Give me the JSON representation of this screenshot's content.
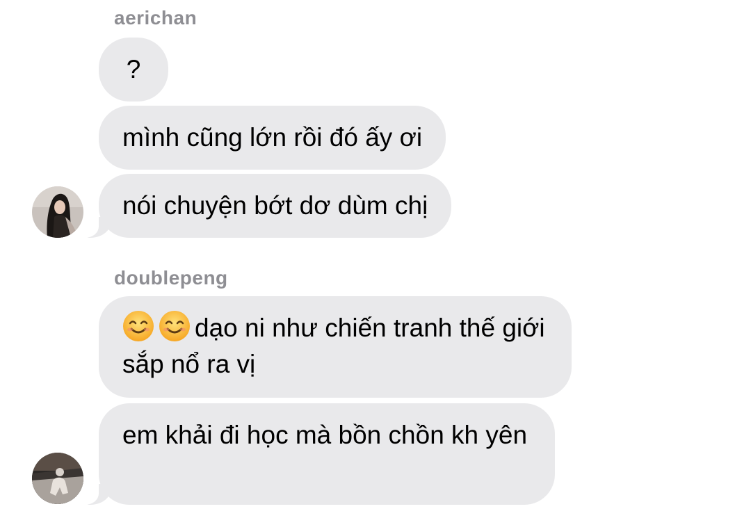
{
  "thread": [
    {
      "sender": "aerichan",
      "messages": [
        "?",
        "mình cũng lớn rồi đó ấy ơi",
        "nói chuyện bớt dơ dùm chị"
      ]
    },
    {
      "sender": "doublepeng",
      "messages": [
        "dạo ni như chiến tranh thế giới sắp nổ ra vị",
        "em khải đi học mà bồn chồn kh yên"
      ]
    }
  ],
  "icons": {
    "avatar_aerichan": "profile-photo-avatar",
    "avatar_doublepeng": "profile-photo-avatar",
    "emoji": "smiling-face-with-smiling-eyes"
  },
  "colors": {
    "bubble": "#e9e9eb",
    "sender_name": "#8e8e93",
    "text": "#000000"
  }
}
